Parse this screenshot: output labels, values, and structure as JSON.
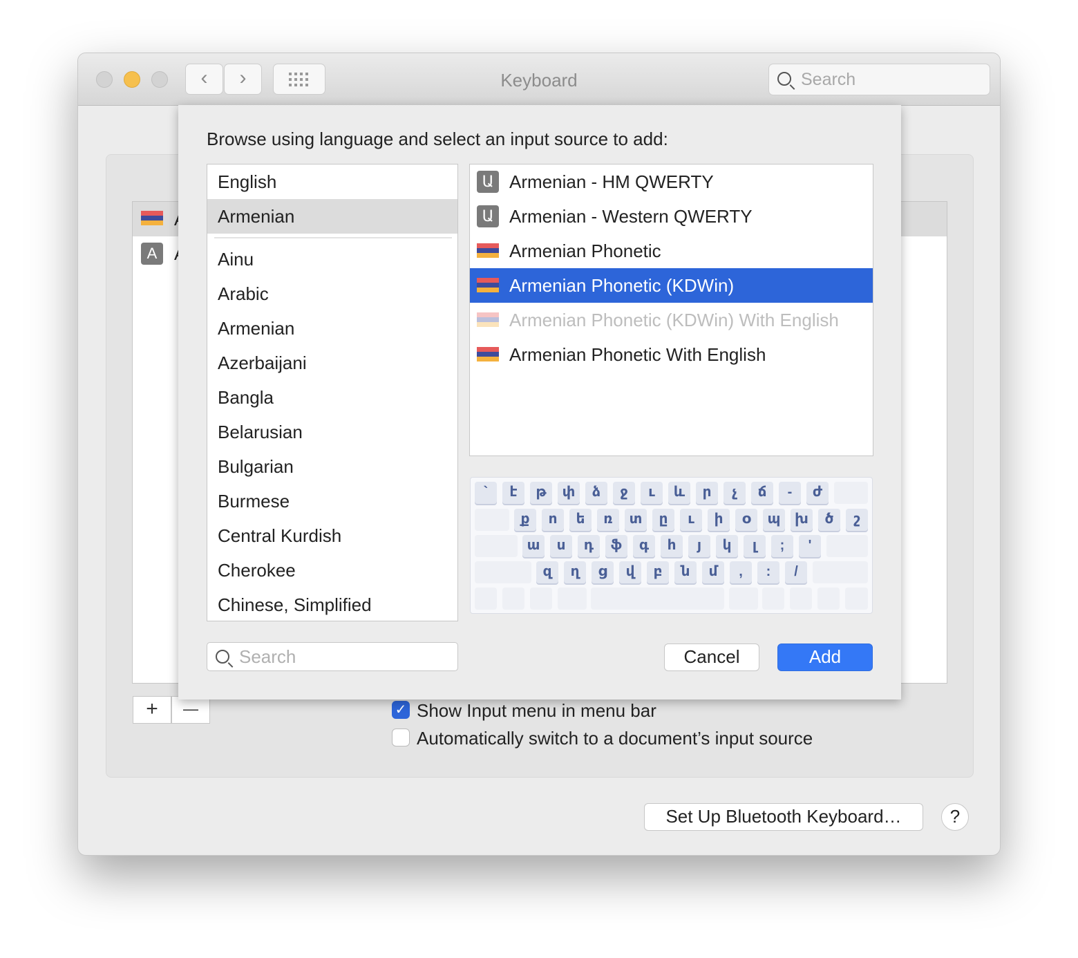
{
  "window": {
    "title": "Keyboard",
    "search_placeholder": "Search",
    "nav_back": "‹",
    "nav_forward": "›"
  },
  "background": {
    "sources": [
      {
        "icon": "armenian-flag-icon",
        "label": "A"
      },
      {
        "icon": "letter-a-icon",
        "icon_text": "A",
        "label": "A"
      }
    ],
    "add": "+",
    "remove": "—",
    "show_input_menu": {
      "label": "Show Input menu in menu bar",
      "checked": true
    },
    "auto_switch": {
      "label": "Automatically switch to a document’s input source",
      "checked": false
    },
    "bluetooth": "Set Up Bluetooth Keyboard…",
    "help": "?"
  },
  "sheet": {
    "prompt": "Browse using language and select an input source to add:",
    "preferred_languages": [
      "English",
      "Armenian"
    ],
    "selected_language": "Armenian",
    "languages": [
      "Ainu",
      "Arabic",
      "Armenian",
      "Azerbaijani",
      "Bangla",
      "Belarusian",
      "Bulgarian",
      "Burmese",
      "Central Kurdish",
      "Cherokee",
      "Chinese, Simplified"
    ],
    "sources": [
      {
        "label": "Armenian - HM QWERTY",
        "icon": "armenian-letter-icon",
        "icon_text": "Ա"
      },
      {
        "label": "Armenian - Western QWERTY",
        "icon": "armenian-letter-icon",
        "icon_text": "Ա"
      },
      {
        "label": "Armenian Phonetic",
        "icon": "armenian-flag-icon"
      },
      {
        "label": "Armenian Phonetic (KDWin)",
        "icon": "armenian-flag-icon",
        "selected": true
      },
      {
        "label": "Armenian Phonetic (KDWin) With English",
        "icon": "armenian-flag-icon",
        "disabled": true
      },
      {
        "label": "Armenian Phonetic With English",
        "icon": "armenian-flag-icon"
      }
    ],
    "keyboard_rows": [
      [
        "`",
        "է",
        "թ",
        "փ",
        "ձ",
        "ջ",
        "ւ",
        "և",
        "ր",
        "չ",
        "ճ",
        "-",
        "ժ"
      ],
      [
        "ք",
        "ո",
        "ե",
        "ռ",
        "տ",
        "ը",
        "ւ",
        "ի",
        "օ",
        "պ",
        "խ",
        "ծ",
        "շ"
      ],
      [
        "ա",
        "ս",
        "դ",
        "ֆ",
        "գ",
        "հ",
        "յ",
        "կ",
        "լ",
        ";",
        "'"
      ],
      [
        "զ",
        "ղ",
        "ց",
        "վ",
        "բ",
        "ն",
        "մ",
        ",",
        ":",
        "/"
      ]
    ],
    "search_placeholder": "Search",
    "cancel": "Cancel",
    "add": "Add"
  },
  "colors": {
    "accent": "#2d65d9",
    "flag_red": "#e65a5a",
    "flag_blue": "#3e4b9c",
    "flag_orange": "#f4b13e",
    "key_text": "#4a5f96"
  }
}
